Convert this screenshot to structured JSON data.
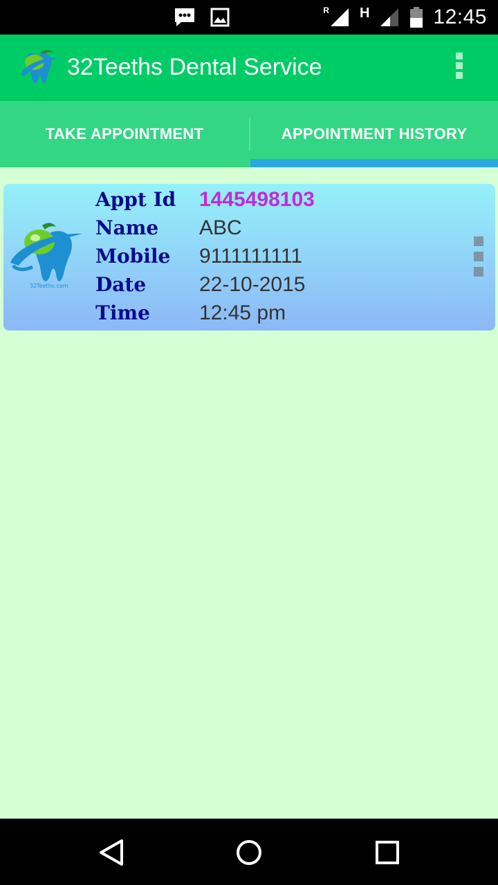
{
  "status_bar": {
    "time": "12:45",
    "network_r": "R",
    "network_h": "H",
    "icons": [
      "sms-icon",
      "image-icon",
      "signal-icon",
      "signal-icon",
      "battery-icon"
    ]
  },
  "app_bar": {
    "title": "32Teeths Dental Service",
    "icons": [
      "tooth-logo-icon",
      "overflow-menu-icon"
    ]
  },
  "tabs": [
    {
      "label": "TAKE APPOINTMENT",
      "selected": false
    },
    {
      "label": "APPOINTMENT HISTORY",
      "selected": true
    }
  ],
  "appointment": {
    "rows": [
      {
        "label": "Appt Id",
        "value": "1445498103"
      },
      {
        "label": "Name",
        "value": "ABC"
      },
      {
        "label": "Mobile",
        "value": "9111111111"
      },
      {
        "label": "Date",
        "value": "22-10-2015"
      },
      {
        "label": "Time",
        "value": "12:45 pm"
      }
    ]
  },
  "colors": {
    "app_bar": "#00cc66",
    "tabs": "#33d685",
    "indicator": "#29a8e0",
    "content_bg": "#d5ffd5",
    "label_text": "#0a0a8c",
    "id_text": "#c22cd6"
  },
  "nav_bar": {
    "icons": [
      "back-icon",
      "home-icon",
      "recents-icon"
    ]
  }
}
